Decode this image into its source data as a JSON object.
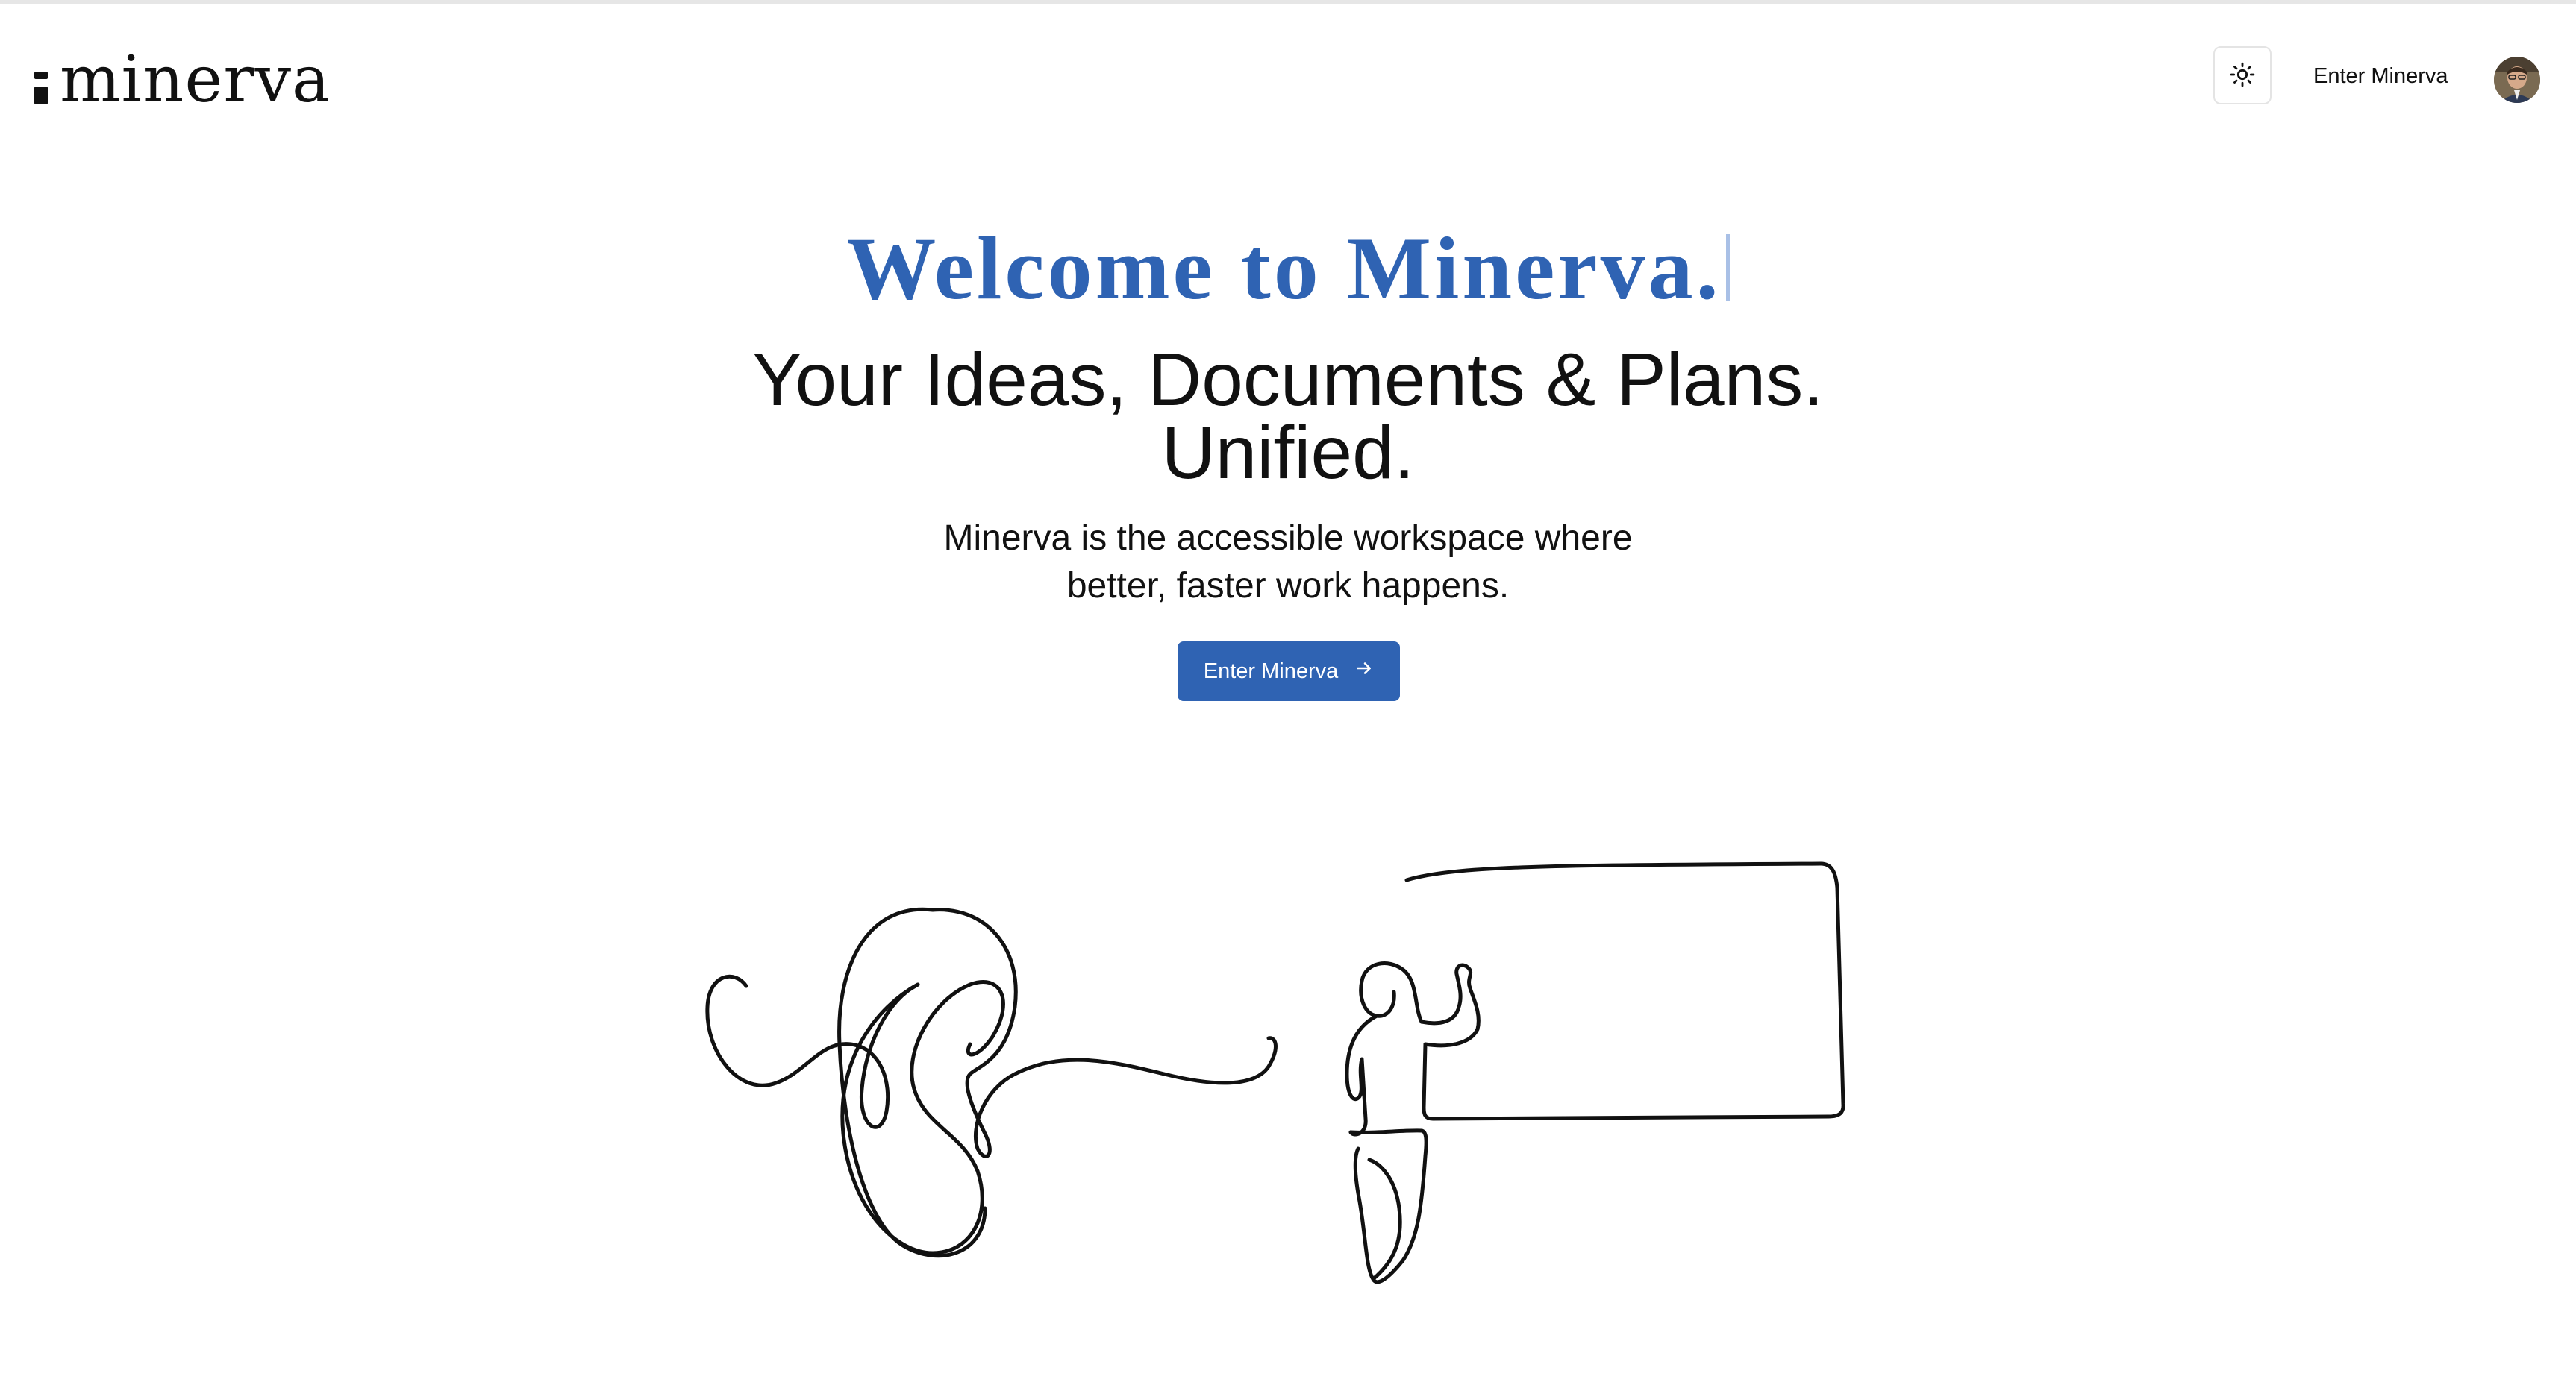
{
  "header": {
    "logo_text": "minerva",
    "theme_toggle_icon": "sun-icon",
    "nav_link": "Enter Minerva",
    "avatar_icon": "user-avatar"
  },
  "hero": {
    "welcome": "Welcome to Minerva.",
    "headline_line1": "Your Ideas, Documents & Plans.",
    "headline_line2": "Unified.",
    "subtext_line1": "Minerva is the accessible workspace where",
    "subtext_line2": "better, faster work happens.",
    "cta_label": "Enter Minerva",
    "cta_icon": "arrow-right-icon"
  },
  "colors": {
    "accent": "#2f63b3",
    "text": "#111111",
    "background": "#ffffff"
  },
  "illustration": {
    "icon": "line-art-ear-and-person-at-whiteboard"
  }
}
